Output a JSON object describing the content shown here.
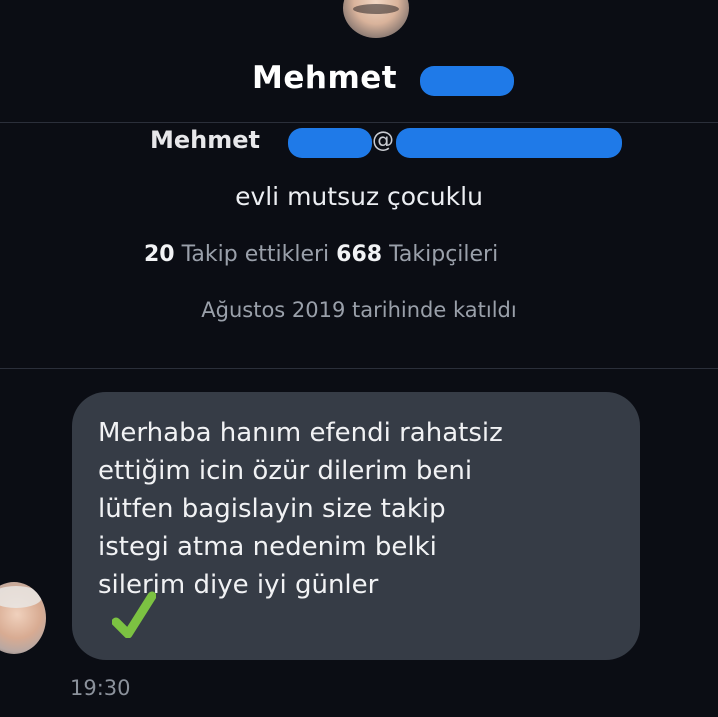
{
  "profile": {
    "display_name": "Mehmet",
    "handle_name": "Mehmet",
    "handle_at": "@",
    "bio": "evli mutsuz çocuklu",
    "following_count": "20",
    "following_label": "Takip ettikleri",
    "followers_count": "668",
    "followers_label": "Takipçileri",
    "joined": "Ağustos 2019 tarihinde katıldı"
  },
  "message": {
    "lines": [
      "Merhaba hanım efendi rahatsiz",
      "ettiğim icin özür dilerim beni",
      "lütfen bagislayin size takip",
      "istegi atma nedenim belki",
      "silerim diye iyi günler"
    ],
    "time": "19:30"
  },
  "colors": {
    "background": "#0b0d14",
    "bubble": "#363c46",
    "redaction": "#1f7ae8",
    "checkmark": "#7cc242"
  }
}
